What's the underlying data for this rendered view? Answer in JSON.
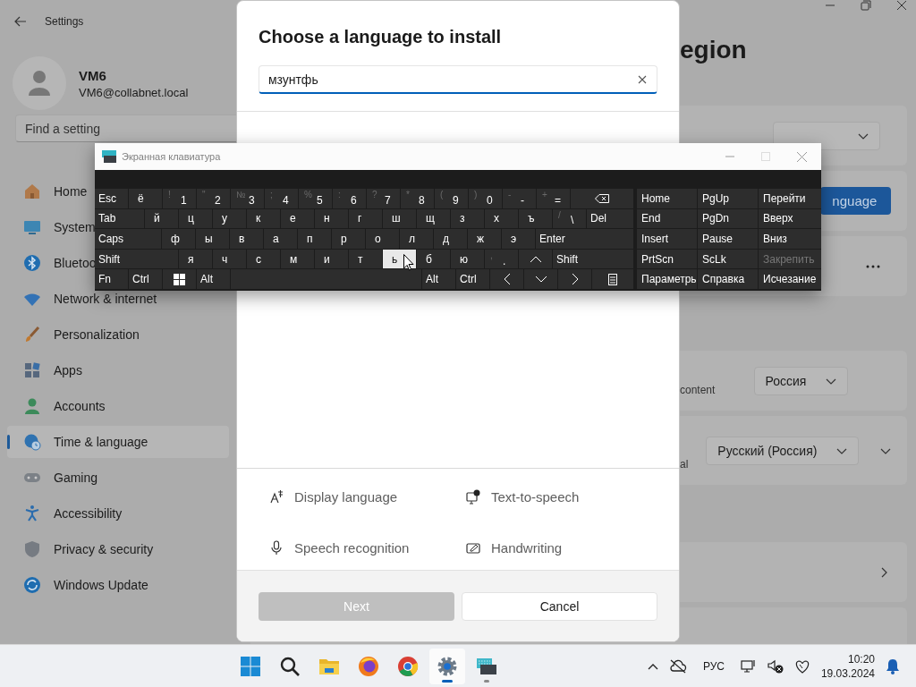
{
  "settings": {
    "title": "Settings",
    "user": {
      "name": "VM6",
      "email": "VM6@collabnet.local"
    },
    "search": {
      "placeholder": "Find a setting"
    },
    "nav": [
      {
        "label": "Home",
        "selected": false
      },
      {
        "label": "System",
        "selected": false
      },
      {
        "label": "Bluetoo",
        "selected": false
      },
      {
        "label": "Network & internet",
        "selected": false
      },
      {
        "label": "Personalization",
        "selected": false
      },
      {
        "label": "Apps",
        "selected": false
      },
      {
        "label": "Accounts",
        "selected": false
      },
      {
        "label": "Time & language",
        "selected": true
      },
      {
        "label": "Gaming",
        "selected": false
      },
      {
        "label": "Accessibility",
        "selected": false
      },
      {
        "label": "Privacy & security",
        "selected": false
      },
      {
        "label": "Windows Update",
        "selected": false
      }
    ],
    "page_title": "egion",
    "card_groups": [
      [
        {
          "kind": "select"
        },
        {
          "kind": "button",
          "button": "nguage"
        },
        {
          "kind": "more"
        }
      ],
      [
        {
          "kind": "select",
          "text": "content",
          "value": "Россия"
        },
        {
          "kind": "select-expand",
          "text": "al",
          "value": "Русский (Россия)"
        }
      ],
      [
        {
          "kind": "link"
        },
        {
          "kind": "plain"
        }
      ]
    ]
  },
  "dialog": {
    "title": "Choose a language to install",
    "search": {
      "value": "мзунтфь"
    },
    "features": [
      {
        "label": "Display language"
      },
      {
        "label": "Text-to-speech"
      },
      {
        "label": "Speech recognition"
      },
      {
        "label": "Handwriting"
      }
    ],
    "buttons": [
      {
        "kind": "primary",
        "label": "Next",
        "disabled": true
      },
      {
        "kind": "secondary",
        "label": "Cancel",
        "disabled": false
      }
    ]
  },
  "keyboard": {
    "title": "Экранная клавиатура",
    "rows": [
      [
        {
          "kind": "mod",
          "label": "Esc",
          "pressed": false
        },
        {
          "label": "ё",
          "pressed": false
        },
        {
          "kind": "digit",
          "shift": "!",
          "label": "1",
          "pressed": false
        },
        {
          "kind": "digit",
          "shift": "\"",
          "label": "2",
          "pressed": false
        },
        {
          "kind": "digit",
          "shift": "№",
          "label": "3",
          "pressed": false
        },
        {
          "kind": "digit",
          "shift": ";",
          "label": "4",
          "pressed": false
        },
        {
          "kind": "digit",
          "shift": "%",
          "label": "5",
          "pressed": false
        },
        {
          "kind": "digit",
          "shift": ":",
          "label": "6",
          "pressed": false
        },
        {
          "kind": "digit",
          "shift": "?",
          "label": "7",
          "pressed": false
        },
        {
          "kind": "digit",
          "shift": "*",
          "label": "8",
          "pressed": false
        },
        {
          "kind": "digit",
          "shift": "(",
          "label": "9",
          "pressed": false
        },
        {
          "kind": "digit",
          "shift": ")",
          "label": "0",
          "pressed": false
        },
        {
          "kind": "digit",
          "shift": "-",
          "label": "-",
          "pressed": false
        },
        {
          "kind": "digit",
          "shift": "+",
          "label": "=",
          "pressed": false
        },
        {
          "kind": "backspace",
          "pressed": false
        }
      ],
      [
        {
          "kind": "mod",
          "label": "Tab",
          "pressed": false
        },
        {
          "label": "й",
          "pressed": false
        },
        {
          "label": "ц",
          "pressed": false
        },
        {
          "label": "у",
          "pressed": false
        },
        {
          "label": "к",
          "pressed": false
        },
        {
          "label": "е",
          "pressed": false
        },
        {
          "label": "н",
          "pressed": false
        },
        {
          "label": "г",
          "pressed": false
        },
        {
          "label": "ш",
          "pressed": false
        },
        {
          "label": "щ",
          "pressed": false
        },
        {
          "label": "з",
          "pressed": false
        },
        {
          "label": "х",
          "pressed": false
        },
        {
          "label": "ъ",
          "pressed": false
        },
        {
          "kind": "digit",
          "shift": "/",
          "label": "\\",
          "pressed": false
        },
        {
          "kind": "mod",
          "label": "Del",
          "pressed": false
        }
      ],
      [
        {
          "kind": "mod",
          "label": "Caps",
          "pressed": false
        },
        {
          "label": "ф",
          "pressed": false
        },
        {
          "label": "ы",
          "pressed": false
        },
        {
          "label": "в",
          "pressed": false
        },
        {
          "label": "а",
          "pressed": false
        },
        {
          "label": "п",
          "pressed": false
        },
        {
          "label": "р",
          "pressed": false
        },
        {
          "label": "о",
          "pressed": false
        },
        {
          "label": "л",
          "pressed": false
        },
        {
          "label": "д",
          "pressed": false
        },
        {
          "label": "ж",
          "pressed": false
        },
        {
          "label": "э",
          "pressed": false
        },
        {
          "kind": "mod",
          "label": "Enter",
          "pressed": false
        }
      ],
      [
        {
          "kind": "mod",
          "label": "Shift",
          "pressed": false
        },
        {
          "label": "я",
          "pressed": false
        },
        {
          "label": "ч",
          "pressed": false
        },
        {
          "label": "с",
          "pressed": false
        },
        {
          "label": "м",
          "pressed": false
        },
        {
          "label": "и",
          "pressed": false
        },
        {
          "label": "т",
          "pressed": false
        },
        {
          "label": "ь",
          "pressed": true
        },
        {
          "label": "б",
          "pressed": false
        },
        {
          "label": "ю",
          "pressed": false
        },
        {
          "kind": "digit",
          "shift": ",",
          "label": ".",
          "pressed": false
        },
        {
          "kind": "up",
          "pressed": false
        },
        {
          "kind": "mod",
          "label": "Shift",
          "pressed": false
        }
      ],
      [
        {
          "kind": "mod",
          "label": "Fn",
          "pressed": false
        },
        {
          "kind": "mod",
          "label": "Ctrl",
          "pressed": false
        },
        {
          "kind": "windows",
          "pressed": false
        },
        {
          "kind": "mod",
          "label": "Alt",
          "pressed": false
        },
        {
          "kind": "space",
          "pressed": false
        },
        {
          "kind": "mod",
          "label": "Alt",
          "pressed": false
        },
        {
          "kind": "mod",
          "label": "Ctrl",
          "pressed": false
        },
        {
          "kind": "left",
          "pressed": false
        },
        {
          "kind": "down",
          "pressed": false
        },
        {
          "kind": "right",
          "pressed": false
        },
        {
          "kind": "menu",
          "pressed": false
        }
      ]
    ],
    "nav_keys": [
      {
        "label": "Home",
        "disabled": false
      },
      {
        "label": "PgUp",
        "disabled": false
      },
      {
        "label": "Перейти",
        "disabled": false
      },
      {
        "label": "End",
        "disabled": false
      },
      {
        "label": "PgDn",
        "disabled": false
      },
      {
        "label": "Вверх",
        "disabled": false
      },
      {
        "label": "Insert",
        "disabled": false
      },
      {
        "label": "Pause",
        "disabled": false
      },
      {
        "label": "Вниз",
        "disabled": false
      },
      {
        "label": "PrtScn",
        "disabled": false
      },
      {
        "label": "ScLk",
        "disabled": false
      },
      {
        "label": "Закрепить",
        "disabled": true
      },
      {
        "label": "Параметрь",
        "disabled": false
      },
      {
        "label": "Справка",
        "disabled": false
      },
      {
        "label": "Исчезание",
        "disabled": false
      }
    ]
  },
  "taskbar": {
    "apps": [
      {
        "active": false,
        "running": false
      },
      {
        "active": false,
        "running": false
      },
      {
        "active": false,
        "running": false
      },
      {
        "active": false,
        "running": false
      },
      {
        "active": false,
        "running": false
      },
      {
        "active": true,
        "running": true
      },
      {
        "active": false,
        "running": true
      }
    ],
    "language": "РУС",
    "time": "10:20",
    "date": "19.03.2024"
  }
}
